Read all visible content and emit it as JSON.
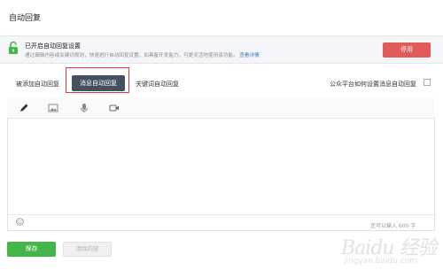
{
  "page": {
    "title": "自动回复"
  },
  "notice": {
    "title": "已开启自动回复设置",
    "description": "通过编辑内容或关键词规则，快速进行自动回复设置。如具备开发能力，可更灵活地使用该功能。",
    "link_label": "查看详情",
    "disable_label": "停用"
  },
  "tabs": [
    {
      "label": "被添加自动回复"
    },
    {
      "label": "消息自动回复",
      "active": true
    },
    {
      "label": "关键词自动回复"
    }
  ],
  "help": {
    "label": "公众平台如何设置消息自动回复"
  },
  "editor": {
    "tools": [
      "pencil-icon",
      "image-icon",
      "microphone-icon",
      "video-icon"
    ],
    "value": "",
    "char_count": "还可以输入 600 字"
  },
  "actions": {
    "save_label": "保存",
    "clear_label": "清除内容"
  },
  "watermark": {
    "text": "Baidu 经验",
    "sub": "jingyan.baidu.com"
  },
  "colors": {
    "accent_green": "#44b549",
    "danger_red": "#e05a5a",
    "tab_active": "#44505f",
    "link_blue": "#3b7bbf"
  }
}
